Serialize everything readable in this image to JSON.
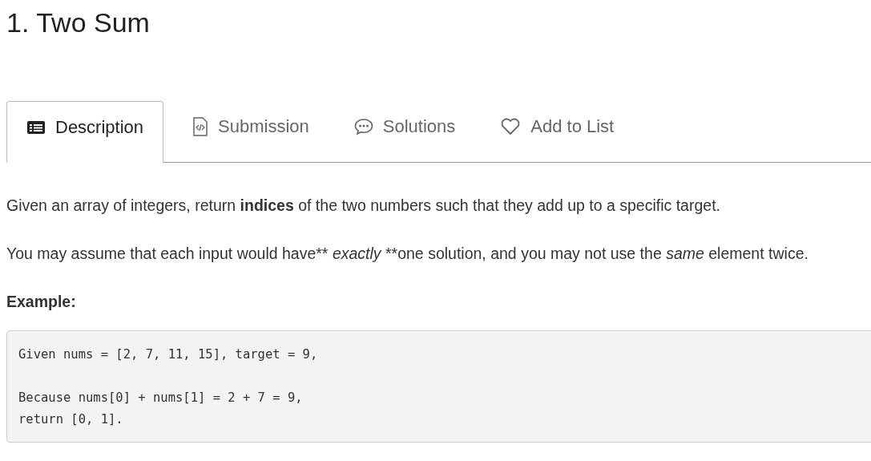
{
  "title": "1. Two Sum",
  "tabs": [
    {
      "label": "Description",
      "kind": "description",
      "selected": true
    },
    {
      "label": "Submission",
      "kind": "submission",
      "selected": false
    },
    {
      "label": "Solutions",
      "kind": "solutions",
      "selected": false
    },
    {
      "label": "Add to List",
      "kind": "list",
      "selected": false
    }
  ],
  "paragraphs": [
    "Given an array of integers, return **indices** of the two numbers such that they add up to a specific target.",
    "You may assume that each input would have** *exactly* **one solution, and you may not use the *same* element twice."
  ],
  "example_heading": "Example:",
  "code_groups": [
    [
      "Given nums = [2, 7, 11, 15], target = 9,"
    ],
    [
      "Because nums[0] + nums[1] = 2 + 7 = 9,",
      "return [0, 1]."
    ]
  ]
}
